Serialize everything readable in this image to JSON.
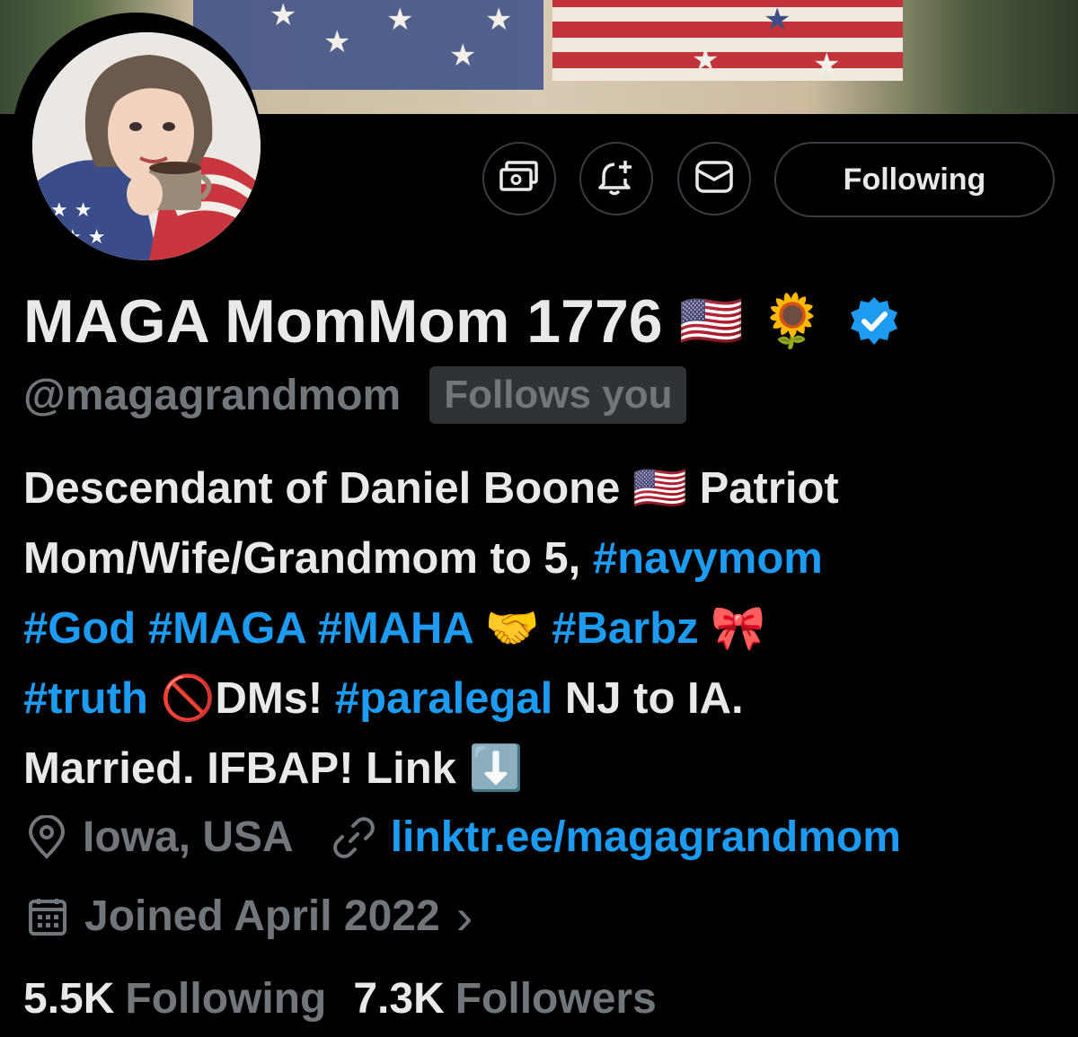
{
  "profile": {
    "display_name": "MAGA MomMom 1776",
    "name_emojis": [
      "🇺🇸",
      "🌻"
    ],
    "handle": "@magagrandmom",
    "follows_you": "Follows you",
    "verified_badge_icon": "verified-badge-icon"
  },
  "actions": {
    "tip_icon": "money-icon",
    "notify_icon": "bell-plus-icon",
    "message_icon": "envelope-icon",
    "follow_label": "Following"
  },
  "bio": {
    "l1a": "Descendant of Daniel Boone ",
    "l1_flag": "🇺🇸",
    "l1b": " Patriot",
    "l2a": "Mom/Wife/Grandmom to 5, ",
    "l2_tag": "#navymom",
    "l3_tag1": "#God #MAGA #MAHA ",
    "l3_emoji1": "🤝",
    "l3_tag2": "#Barbz ",
    "l3_emoji2": "🎀",
    "l4_tag1": "#truth ",
    "l4_emoji": "🚫",
    "l4a": "DMs! ",
    "l4_tag2": "#paralegal",
    "l4b": " NJ to IA.",
    "l5a": "Married. IFBAP! Link ",
    "l5_emoji": "⬇️"
  },
  "meta": {
    "location": "Iowa, USA",
    "link": "linktr.ee/magagrandmom",
    "joined": "Joined April 2022",
    "chevron": "›"
  },
  "stats": {
    "following_count": "5.5K",
    "following_label": "Following",
    "followers_count": "7.3K",
    "followers_label": "Followers"
  },
  "colors": {
    "background": "#000000",
    "text": "#e7e9ea",
    "secondary": "#71767b",
    "accent": "#1d9bf0",
    "border": "#3a3d41"
  }
}
